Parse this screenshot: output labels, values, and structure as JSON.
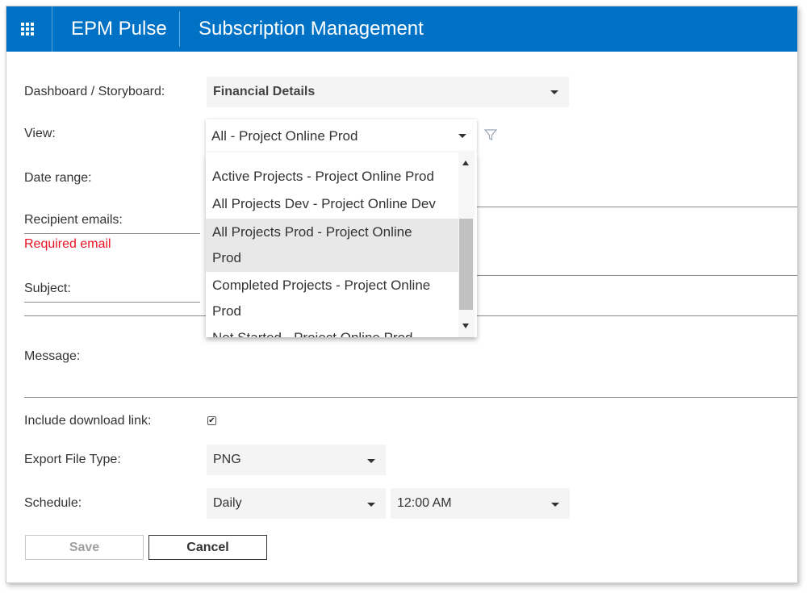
{
  "header": {
    "app_title": "EPM Pulse",
    "page_title": "Subscription Management",
    "brand_color": "#0072c6"
  },
  "form": {
    "dashboard": {
      "label": "Dashboard / Storyboard:",
      "value": "Financial Details"
    },
    "view": {
      "label": "View:",
      "value": "All - Project Online Prod",
      "options": [
        "Active Projects - Project Online Prod",
        "All Projects Dev - Project Online Dev",
        "All Projects Prod - Project Online Prod",
        "Completed Projects - Project Online Prod",
        "Not Started - Project Online Prod"
      ],
      "highlighted_option": "All Projects Prod - Project Online Prod"
    },
    "date_range": {
      "label": "Date range:"
    },
    "recipients": {
      "label": "Recipient emails:",
      "error": "Required email"
    },
    "subject": {
      "label": "Subject:"
    },
    "message": {
      "label": "Message:"
    },
    "include_link": {
      "label": "Include download link:",
      "checked": true
    },
    "export_type": {
      "label": "Export File Type:",
      "value": "PNG"
    },
    "schedule": {
      "label": "Schedule:",
      "frequency": "Daily",
      "time": "12:00 AM"
    }
  },
  "buttons": {
    "save": "Save",
    "cancel": "Cancel"
  },
  "icons": {
    "app_launcher": "waffle-icon",
    "filter": "filter-icon"
  },
  "colors": {
    "error": "#e81123"
  }
}
